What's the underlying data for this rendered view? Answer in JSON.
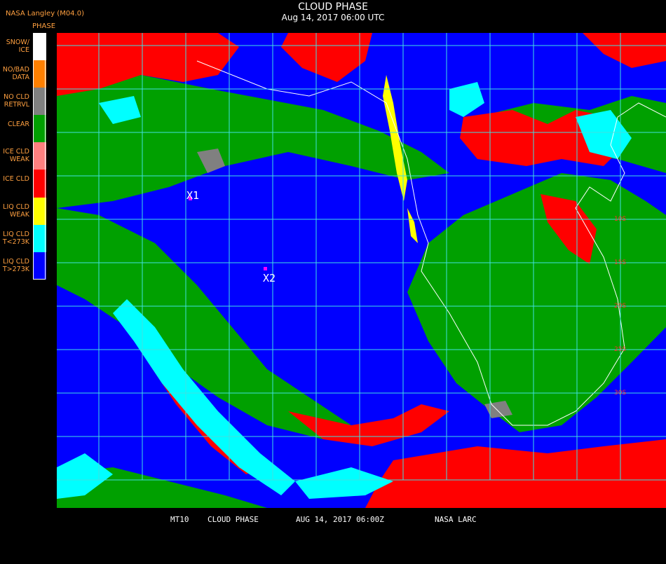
{
  "header": {
    "producer": "NASA Langley (M04.0)",
    "legend_title": "PHASE",
    "title": "CLOUD PHASE",
    "subtitle": "Aug 14, 2017 06:00 UTC"
  },
  "legend": [
    {
      "label": "SNOW/\nICE",
      "color": "#ffffff"
    },
    {
      "label": "NO/BAD\nDATA",
      "color": "#ff8000"
    },
    {
      "label": "NO CLD\nRETRVL",
      "color": "#808080"
    },
    {
      "label": "CLEAR",
      "color": "#00a000"
    },
    {
      "label": "ICE CLD\nWEAK",
      "color": "#ff8080"
    },
    {
      "label": "ICE CLD",
      "color": "#ff0000"
    },
    {
      "label": "LIQ CLD\nWEAK",
      "color": "#ffff00"
    },
    {
      "label": "LIQ CLD\nT<273K",
      "color": "#00ffff"
    },
    {
      "label": "LIQ CLD\nT>273K",
      "color": "#0000ff"
    }
  ],
  "markers": [
    {
      "label": "X1",
      "color": "#ff00ff"
    },
    {
      "label": "X2",
      "color": "#ff00ff"
    }
  ],
  "lat_labels": [
    "10S",
    "15S",
    "20S",
    "25S",
    "30S"
  ],
  "footer": {
    "satellite": "MT10",
    "product": "CLOUD PHASE",
    "datetime": "AUG 14, 2017 06:00Z",
    "agency": "NASA LARC"
  },
  "colors": {
    "grid": "#40e0e0",
    "coast": "#ffffff",
    "label": "#ffa040"
  }
}
